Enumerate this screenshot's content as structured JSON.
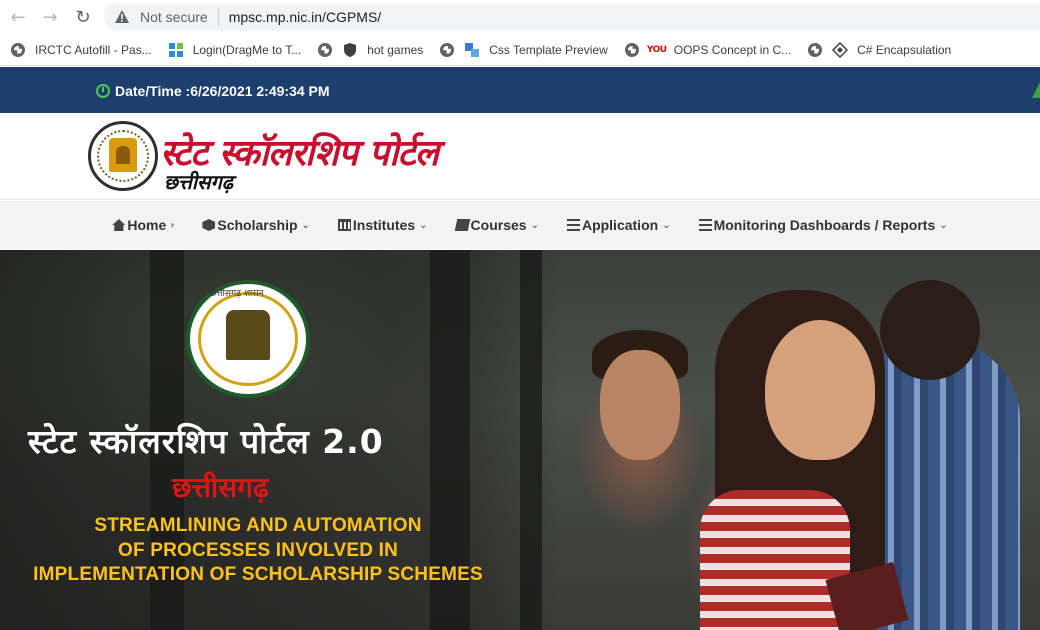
{
  "browser": {
    "not_secure_label": "Not secure",
    "url": "mpsc.mp.nic.in/CGPMS/",
    "bookmarks": [
      {
        "label": "IRCTC Autofill - Pas...",
        "icon": "globe-icon"
      },
      {
        "label": "Login(DragMe to T...",
        "icon": "grid-icon"
      },
      {
        "label": "hot games",
        "icon": "globe-icon"
      },
      {
        "label": "Css Template Preview",
        "icon": "shield-icon"
      },
      {
        "label": "OOPS Concept in C...",
        "icon": "globe-icon"
      },
      {
        "label": "C# Encapsulation",
        "icon": "puzzle-icon"
      }
    ]
  },
  "site": {
    "datetime": "Date/Time :6/26/2021 2:49:34 PM",
    "logo_title": "स्टेट स्कॉलरशिप पोर्टल",
    "logo_subtitle": "छत्तीसगढ़",
    "nav": [
      {
        "label": "Home",
        "icon": "home-icon",
        "chevron": "›"
      },
      {
        "label": "Scholarship",
        "icon": "cube-icon",
        "chevron": "⌄"
      },
      {
        "label": "Institutes",
        "icon": "bank-icon",
        "chevron": "⌄"
      },
      {
        "label": "Courses",
        "icon": "book-icon",
        "chevron": "⌄"
      },
      {
        "label": "Application",
        "icon": "bars-icon",
        "chevron": "⌄"
      },
      {
        "label": "Monitoring Dashboards / Reports",
        "icon": "bars-icon",
        "chevron": "⌄"
      }
    ]
  },
  "banner": {
    "emblem_text": "छत्तीसगढ़ शासन",
    "title": "स्टेट स्कॉलरशिप पोर्टल 2.0",
    "subtitle": "छत्तीसगढ़",
    "tagline": [
      "STREAMLINING AND AUTOMATION",
      "OF PROCESSES INVOLVED IN",
      "IMPLEMENTATION OF SCHOLARSHIP SCHEMES"
    ]
  },
  "colors": {
    "topbar": "#1d3f6e",
    "logo_red": "#c8102e",
    "tagline_yellow": "#ffc21a",
    "nav_bg": "#f3f3f3"
  }
}
